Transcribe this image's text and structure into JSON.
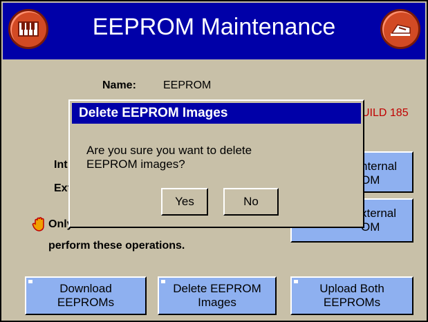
{
  "window": {
    "title": "EEPROM Maintenance",
    "left_icon": "piano-icon",
    "right_icon": "exit-icon"
  },
  "info": {
    "name_label": "Name:",
    "name_value": "EEPROM",
    "build_text": "UILD 185",
    "internal_prefix": "Int",
    "external_prefix": "Ext"
  },
  "side_buttons": {
    "internal": {
      "line1": "nternal",
      "line2": "OM"
    },
    "external": {
      "line1": "xternal",
      "line2": "OM"
    }
  },
  "warning": {
    "icon": "hand-stop-icon",
    "line1": "Only",
    "line2": "perform these operations."
  },
  "bottom_buttons": {
    "download": {
      "line1": "Download",
      "line2": "EEPROMs"
    },
    "delete": {
      "line1": "Delete EEPROM",
      "line2": "Images"
    },
    "upload": {
      "line1": "Upload Both",
      "line2": "EEPROMs"
    }
  },
  "dialog": {
    "title": "Delete EEPROM Images",
    "message_line1": "Are you sure you want to delete",
    "message_line2": "EEPROM images?",
    "yes_label": "Yes",
    "no_label": "No"
  },
  "colors": {
    "titlebar": "#0000a8",
    "background": "#c8c0a8",
    "button": "#8eb0f0",
    "icon_red": "#d24a24",
    "build_text": "#c00000"
  }
}
